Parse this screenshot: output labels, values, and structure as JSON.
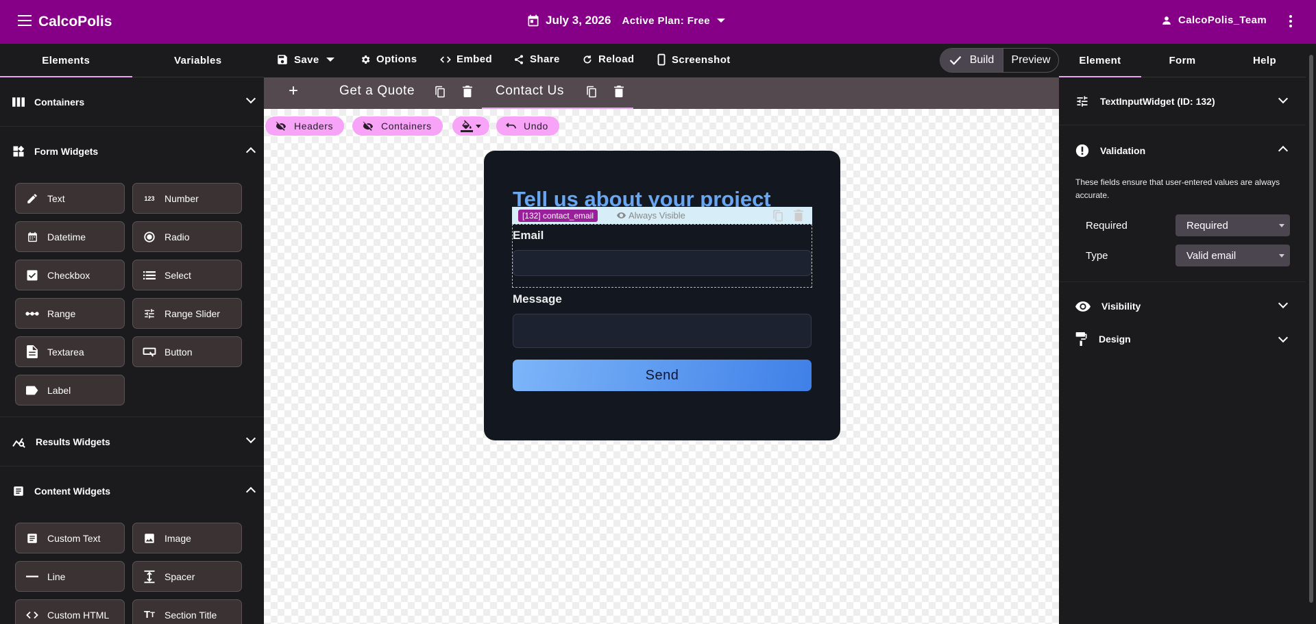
{
  "app": {
    "title": "CalcoPolis",
    "date": "July 3, 2026",
    "plan": "Active Plan: Free",
    "user": "CalcoPolis_Team"
  },
  "left_tabs": [
    "Elements",
    "Variables"
  ],
  "toolbar": {
    "save": "Save",
    "options": "Options",
    "embed": "Embed",
    "share": "Share",
    "reload": "Reload",
    "screenshot": "Screenshot",
    "build": "Build",
    "preview": "Preview"
  },
  "right_tabs": [
    "Element",
    "Form",
    "Help"
  ],
  "sidebar": {
    "containers": "Containers",
    "form_widgets": "Form Widgets",
    "form_widget_items": [
      "Text",
      "Number",
      "Datetime",
      "Radio",
      "Checkbox",
      "Select",
      "Range",
      "Range Slider",
      "Textarea",
      "Button",
      "Label"
    ],
    "results_widgets": "Results Widgets",
    "content_widgets": "Content Widgets",
    "content_widget_items": [
      "Custom Text",
      "Image",
      "Line",
      "Spacer",
      "Custom HTML",
      "Section Title"
    ]
  },
  "canvas": {
    "add": "+",
    "pages": [
      "Get a Quote",
      "Contact Us"
    ],
    "chips": {
      "headers": "Headers",
      "containers": "Containers",
      "undo": "Undo"
    },
    "form_title": "Tell us about your project",
    "selection_tag": "[132] contact_email",
    "selection_visibility": "Always Visible",
    "email_label": "Email",
    "message_label": "Message",
    "send_label": "Send"
  },
  "inspector": {
    "widget_title": "TextInputWidget (ID: 132)",
    "validation": "Validation",
    "validation_desc": "These fields ensure that user-entered values are always accurate.",
    "required_label": "Required",
    "required_value": "Required",
    "type_label": "Type",
    "type_value": "Valid email",
    "visibility": "Visibility",
    "design": "Design"
  },
  "colors": {
    "topbar": "#850086",
    "accent": "#e9a6f0",
    "chip": "#f7a3f7",
    "title_blue": "#6aa7f0",
    "send_start": "#7db5f8",
    "send_end": "#3f80e8"
  }
}
